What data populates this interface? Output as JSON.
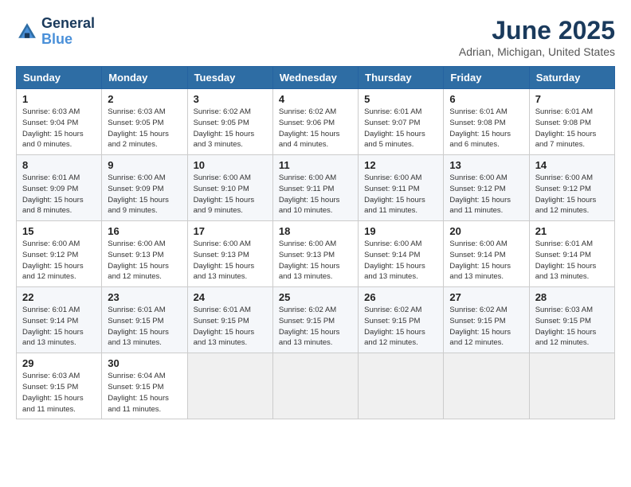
{
  "logo": {
    "line1": "General",
    "line2": "Blue"
  },
  "title": "June 2025",
  "subtitle": "Adrian, Michigan, United States",
  "weekdays": [
    "Sunday",
    "Monday",
    "Tuesday",
    "Wednesday",
    "Thursday",
    "Friday",
    "Saturday"
  ],
  "weeks": [
    [
      {
        "day": "1",
        "sunrise": "6:03 AM",
        "sunset": "9:04 PM",
        "daylight": "15 hours and 0 minutes."
      },
      {
        "day": "2",
        "sunrise": "6:03 AM",
        "sunset": "9:05 PM",
        "daylight": "15 hours and 2 minutes."
      },
      {
        "day": "3",
        "sunrise": "6:02 AM",
        "sunset": "9:05 PM",
        "daylight": "15 hours and 3 minutes."
      },
      {
        "day": "4",
        "sunrise": "6:02 AM",
        "sunset": "9:06 PM",
        "daylight": "15 hours and 4 minutes."
      },
      {
        "day": "5",
        "sunrise": "6:01 AM",
        "sunset": "9:07 PM",
        "daylight": "15 hours and 5 minutes."
      },
      {
        "day": "6",
        "sunrise": "6:01 AM",
        "sunset": "9:08 PM",
        "daylight": "15 hours and 6 minutes."
      },
      {
        "day": "7",
        "sunrise": "6:01 AM",
        "sunset": "9:08 PM",
        "daylight": "15 hours and 7 minutes."
      }
    ],
    [
      {
        "day": "8",
        "sunrise": "6:01 AM",
        "sunset": "9:09 PM",
        "daylight": "15 hours and 8 minutes."
      },
      {
        "day": "9",
        "sunrise": "6:00 AM",
        "sunset": "9:09 PM",
        "daylight": "15 hours and 9 minutes."
      },
      {
        "day": "10",
        "sunrise": "6:00 AM",
        "sunset": "9:10 PM",
        "daylight": "15 hours and 9 minutes."
      },
      {
        "day": "11",
        "sunrise": "6:00 AM",
        "sunset": "9:11 PM",
        "daylight": "15 hours and 10 minutes."
      },
      {
        "day": "12",
        "sunrise": "6:00 AM",
        "sunset": "9:11 PM",
        "daylight": "15 hours and 11 minutes."
      },
      {
        "day": "13",
        "sunrise": "6:00 AM",
        "sunset": "9:12 PM",
        "daylight": "15 hours and 11 minutes."
      },
      {
        "day": "14",
        "sunrise": "6:00 AM",
        "sunset": "9:12 PM",
        "daylight": "15 hours and 12 minutes."
      }
    ],
    [
      {
        "day": "15",
        "sunrise": "6:00 AM",
        "sunset": "9:12 PM",
        "daylight": "15 hours and 12 minutes."
      },
      {
        "day": "16",
        "sunrise": "6:00 AM",
        "sunset": "9:13 PM",
        "daylight": "15 hours and 12 minutes."
      },
      {
        "day": "17",
        "sunrise": "6:00 AM",
        "sunset": "9:13 PM",
        "daylight": "15 hours and 13 minutes."
      },
      {
        "day": "18",
        "sunrise": "6:00 AM",
        "sunset": "9:13 PM",
        "daylight": "15 hours and 13 minutes."
      },
      {
        "day": "19",
        "sunrise": "6:00 AM",
        "sunset": "9:14 PM",
        "daylight": "15 hours and 13 minutes."
      },
      {
        "day": "20",
        "sunrise": "6:00 AM",
        "sunset": "9:14 PM",
        "daylight": "15 hours and 13 minutes."
      },
      {
        "day": "21",
        "sunrise": "6:01 AM",
        "sunset": "9:14 PM",
        "daylight": "15 hours and 13 minutes."
      }
    ],
    [
      {
        "day": "22",
        "sunrise": "6:01 AM",
        "sunset": "9:14 PM",
        "daylight": "15 hours and 13 minutes."
      },
      {
        "day": "23",
        "sunrise": "6:01 AM",
        "sunset": "9:15 PM",
        "daylight": "15 hours and 13 minutes."
      },
      {
        "day": "24",
        "sunrise": "6:01 AM",
        "sunset": "9:15 PM",
        "daylight": "15 hours and 13 minutes."
      },
      {
        "day": "25",
        "sunrise": "6:02 AM",
        "sunset": "9:15 PM",
        "daylight": "15 hours and 13 minutes."
      },
      {
        "day": "26",
        "sunrise": "6:02 AM",
        "sunset": "9:15 PM",
        "daylight": "15 hours and 12 minutes."
      },
      {
        "day": "27",
        "sunrise": "6:02 AM",
        "sunset": "9:15 PM",
        "daylight": "15 hours and 12 minutes."
      },
      {
        "day": "28",
        "sunrise": "6:03 AM",
        "sunset": "9:15 PM",
        "daylight": "15 hours and 12 minutes."
      }
    ],
    [
      {
        "day": "29",
        "sunrise": "6:03 AM",
        "sunset": "9:15 PM",
        "daylight": "15 hours and 11 minutes."
      },
      {
        "day": "30",
        "sunrise": "6:04 AM",
        "sunset": "9:15 PM",
        "daylight": "15 hours and 11 minutes."
      },
      null,
      null,
      null,
      null,
      null
    ]
  ],
  "labels": {
    "sunrise": "Sunrise: ",
    "sunset": "Sunset: ",
    "daylight": "Daylight: "
  }
}
